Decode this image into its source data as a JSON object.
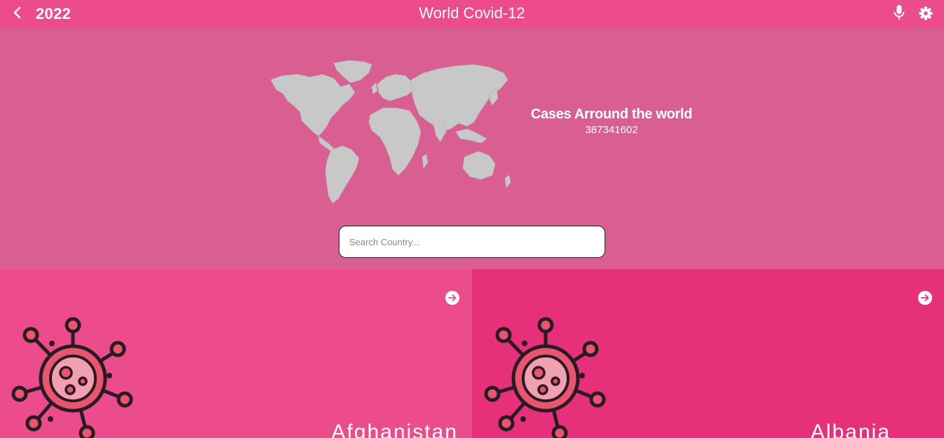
{
  "header": {
    "year": "2022",
    "title": "World Covid-12"
  },
  "hero": {
    "global_title": "Cases Arround the world",
    "global_cases": "387341602"
  },
  "search": {
    "placeholder": "Search Country..."
  },
  "countries": [
    {
      "name": "Afghanistan"
    },
    {
      "name": "Albania"
    }
  ],
  "icons": {
    "back": "chevron-left-icon",
    "mic": "microphone-icon",
    "settings": "gear-icon",
    "card_arrow": "arrow-right-circle-icon",
    "virus": "virus-icon",
    "map": "world-map"
  },
  "colors": {
    "header": "#ec4c8c",
    "hero": "#d95f92",
    "card_left": "#ec4c8c",
    "card_right": "#e6307a",
    "map": "#c8c8c8",
    "virus_body": "#e9556f",
    "virus_outline": "#2a1a22"
  }
}
